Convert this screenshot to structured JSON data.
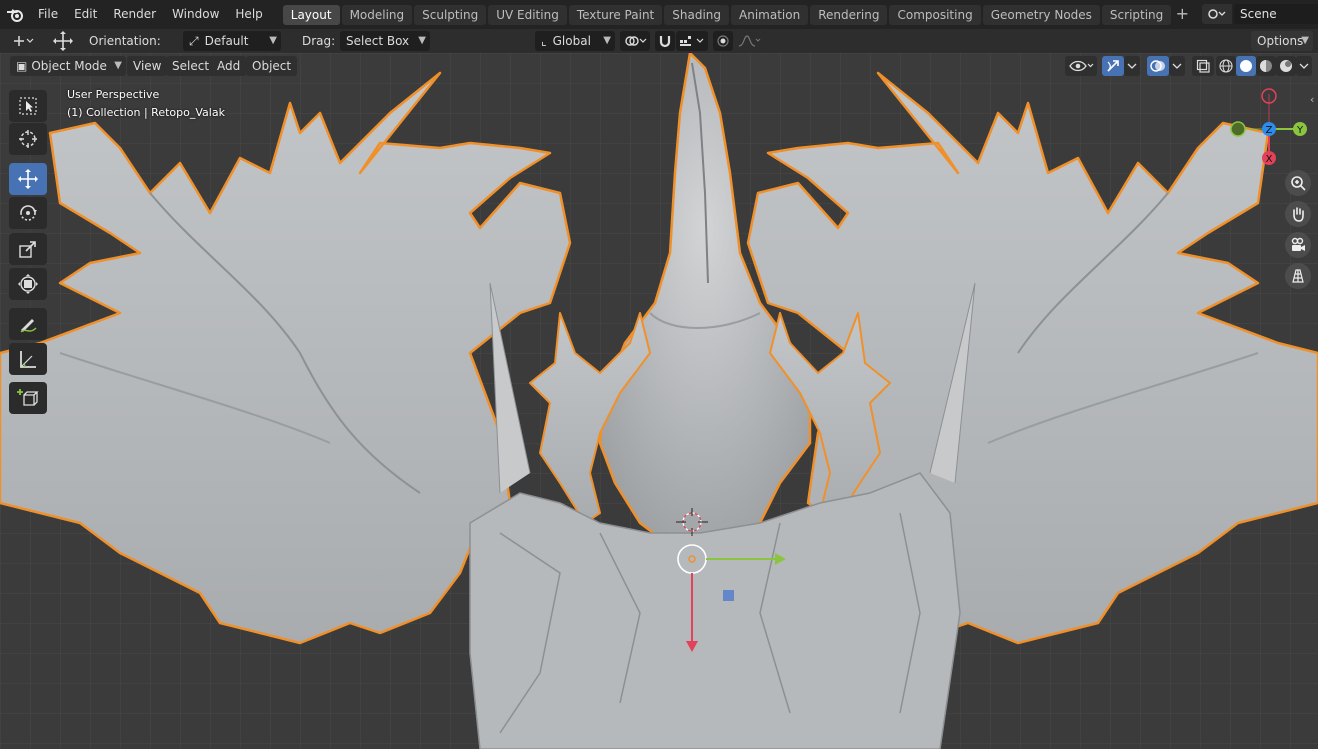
{
  "topbar": {
    "menu": [
      "File",
      "Edit",
      "Render",
      "Window",
      "Help"
    ],
    "tabs": [
      "Layout",
      "Modeling",
      "Sculpting",
      "UV Editing",
      "Texture Paint",
      "Shading",
      "Animation",
      "Rendering",
      "Compositing",
      "Geometry Nodes",
      "Scripting"
    ],
    "active_tab": "Layout",
    "scene": "Scene"
  },
  "toolheader": {
    "orientation_label": "Orientation:",
    "orientation_value": "Default",
    "drag_label": "Drag:",
    "drag_value": "Select Box",
    "transform_orientation": "Global",
    "options": "Options"
  },
  "viewport_header": {
    "mode": "Object Mode",
    "menus": [
      "View",
      "Select",
      "Add",
      "Object"
    ]
  },
  "viewport": {
    "perspective": "User Perspective",
    "collection": "(1) Collection | Retopo_Valak"
  },
  "gizmo": {
    "x": "X",
    "y": "Y",
    "z": "Z"
  },
  "colors": {
    "accent": "#4772b3",
    "outline": "#f0902a",
    "mesh": "#b9bcbf",
    "grid_bg": "#3c3c3c",
    "x_axis": "#e2415a",
    "y_axis": "#8bc53f",
    "z_axis": "#2d8ceb"
  }
}
